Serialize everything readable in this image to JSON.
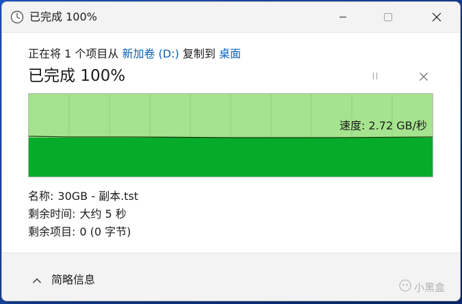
{
  "window": {
    "title": "已完成 100%",
    "controls": {
      "minimize_icon": "minimize-icon",
      "maximize_icon": "maximize-icon",
      "close_icon": "close-icon"
    },
    "title_icon": "clock-icon"
  },
  "copy_line": {
    "prefix": "正在将 1 个项目从",
    "source": "新加卷 (D:)",
    "middle": "复制到",
    "destination": "桌面"
  },
  "status": {
    "headline": "已完成 100%",
    "progress_percent": 100
  },
  "graph": {
    "speed_label": "速度: 2.72 GB/秒",
    "progress_fraction": 1.0,
    "colors": {
      "progress_fill": "#a6e38f",
      "speed_fill": "#06ab2a",
      "grid": "#8fd07a",
      "speed_line": "#1b3a12"
    }
  },
  "details": {
    "name_key": "名称:",
    "name_value": "30GB - 副本.tst",
    "time_key": "剩余时间:",
    "time_value": "大约 5 秒",
    "items_key": "剩余项目:",
    "items_value": "0 (0 字节)"
  },
  "footer": {
    "less_info_label": "简略信息",
    "chevron_icon": "chevron-up-icon"
  },
  "watermark": {
    "text": "小黑盒"
  },
  "colors": {
    "link": "#0a5fb4",
    "titlebar_bg": "#f3f3f3",
    "footer_bg": "#f3f3f3"
  }
}
